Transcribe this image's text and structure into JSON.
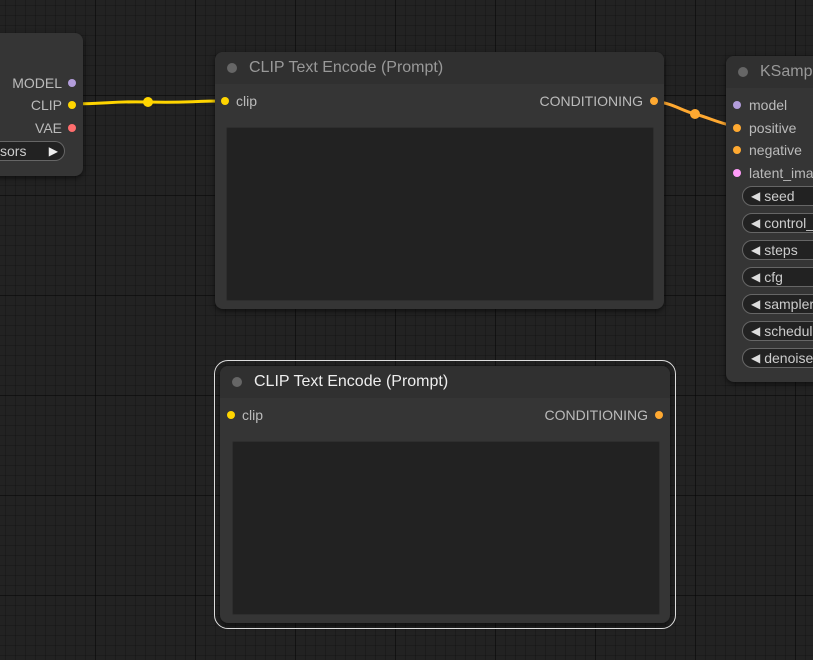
{
  "colors": {
    "clip": "#ffd500",
    "conditioning": "#ffa931",
    "model": "#b39ddb",
    "vae": "#ff6e6e",
    "latent": "#ff9cf9"
  },
  "checkpoint_node": {
    "outputs": [
      "MODEL",
      "CLIP",
      "VAE"
    ],
    "widget_label": "sors"
  },
  "clip_node_1": {
    "title": "CLIP Text Encode (Prompt)",
    "input_label": "clip",
    "output_label": "CONDITIONING"
  },
  "clip_node_2": {
    "title": "CLIP Text Encode (Prompt)",
    "input_label": "clip",
    "output_label": "CONDITIONING"
  },
  "ksampler_node": {
    "title": "KSampl",
    "inputs": [
      "model",
      "positive",
      "negative",
      "latent_imag"
    ],
    "widgets": [
      "seed",
      "control_",
      "steps",
      "cfg",
      "sampler",
      "schedule",
      "denoise"
    ]
  }
}
